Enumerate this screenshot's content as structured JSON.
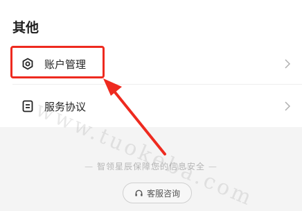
{
  "section": {
    "title": "其他"
  },
  "rows": [
    {
      "label": "账户管理",
      "icon": "hexagon-settings-icon"
    },
    {
      "label": "服务协议",
      "icon": "document-icon"
    }
  ],
  "footer": {
    "security_text": "智领星辰保障您的信息安全",
    "support_label": "客服咨询",
    "support_icon": "headset-icon"
  },
  "annotation": {
    "highlight_color": "#ee2a1f",
    "highlight_target": "账户管理"
  },
  "watermark": {
    "text": "www.tuokeba.com"
  }
}
